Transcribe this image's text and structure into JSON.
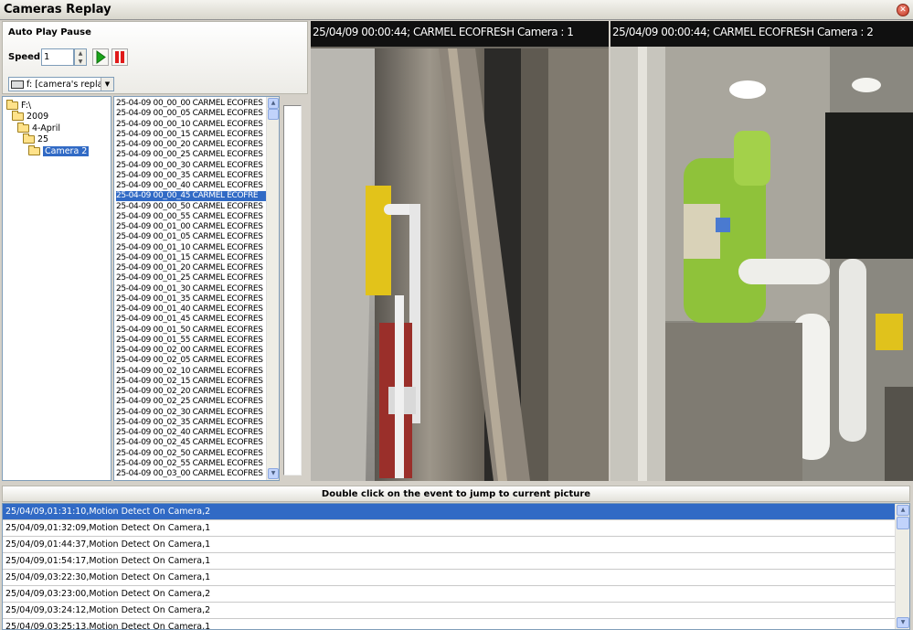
{
  "window": {
    "title": "Cameras Replay"
  },
  "controls": {
    "auto_play_label": "Auto Play Pause",
    "speed_label": "Speed",
    "speed_value": "1",
    "drive_select": "f: [camera's replay]"
  },
  "tree": [
    {
      "label": "F:\\",
      "level": 0,
      "selected": false
    },
    {
      "label": "2009",
      "level": 1,
      "selected": false
    },
    {
      "label": "4-April",
      "level": 2,
      "selected": false
    },
    {
      "label": "25",
      "level": 3,
      "selected": false
    },
    {
      "label": "Camera 2",
      "level": 4,
      "selected": true
    }
  ],
  "files": [
    "25-04-09 00_00_00 CARMEL ECOFRES",
    "25-04-09 00_00_05 CARMEL ECOFRES",
    "25-04-09 00_00_10 CARMEL ECOFRES",
    "25-04-09 00_00_15 CARMEL ECOFRES",
    "25-04-09 00_00_20 CARMEL ECOFRES",
    "25-04-09 00_00_25 CARMEL ECOFRES",
    "25-04-09 00_00_30 CARMEL ECOFRES",
    "25-04-09 00_00_35 CARMEL ECOFRES",
    "25-04-09 00_00_40 CARMEL ECOFRES",
    "25-04-09 00_00_45 CARMEL ECOFRE",
    "25-04-09 00_00_50 CARMEL ECOFRES",
    "25-04-09 00_00_55 CARMEL ECOFRES",
    "25-04-09 00_01_00 CARMEL ECOFRES",
    "25-04-09 00_01_05 CARMEL ECOFRES",
    "25-04-09 00_01_10 CARMEL ECOFRES",
    "25-04-09 00_01_15 CARMEL ECOFRES",
    "25-04-09 00_01_20 CARMEL ECOFRES",
    "25-04-09 00_01_25 CARMEL ECOFRES",
    "25-04-09 00_01_30 CARMEL ECOFRES",
    "25-04-09 00_01_35 CARMEL ECOFRES",
    "25-04-09 00_01_40 CARMEL ECOFRES",
    "25-04-09 00_01_45 CARMEL ECOFRES",
    "25-04-09 00_01_50 CARMEL ECOFRES",
    "25-04-09 00_01_55 CARMEL ECOFRES",
    "25-04-09 00_02_00 CARMEL ECOFRES",
    "25-04-09 00_02_05 CARMEL ECOFRES",
    "25-04-09 00_02_10 CARMEL ECOFRES",
    "25-04-09 00_02_15 CARMEL ECOFRES",
    "25-04-09 00_02_20 CARMEL ECOFRES",
    "25-04-09 00_02_25 CARMEL ECOFRES",
    "25-04-09 00_02_30 CARMEL ECOFRES",
    "25-04-09 00_02_35 CARMEL ECOFRES",
    "25-04-09 00_02_40 CARMEL ECOFRES",
    "25-04-09 00_02_45 CARMEL ECOFRES",
    "25-04-09 00_02_50 CARMEL ECOFRES",
    "25-04-09 00_02_55 CARMEL ECOFRES",
    "25-04-09 00_03_00 CARMEL ECOFRES"
  ],
  "selected_file_index": 9,
  "cameras": [
    {
      "caption": "25/04/09 00:00:44; CARMEL ECOFRESH Camera : 1"
    },
    {
      "caption": "25/04/09 00:00:44; CARMEL ECOFRESH Camera : 2"
    }
  ],
  "events_header": "Double click on the event to jump to current picture",
  "events": [
    "25/04/09,01:31:10,Motion Detect On Camera,2",
    "25/04/09,01:32:09,Motion Detect On Camera,1",
    "25/04/09,01:44:37,Motion Detect On Camera,1",
    "25/04/09,01:54:17,Motion Detect On Camera,1",
    "25/04/09,03:22:30,Motion Detect On Camera,1",
    "25/04/09,03:23:00,Motion Detect On Camera,2",
    "25/04/09,03:24:12,Motion Detect On Camera,2",
    "25/04/09,03:25:13,Motion Detect On Camera,1"
  ],
  "selected_event_index": 0,
  "colors": {
    "selection": "#316ac5",
    "play": "#1aa51a",
    "pause": "#e01a1a"
  }
}
